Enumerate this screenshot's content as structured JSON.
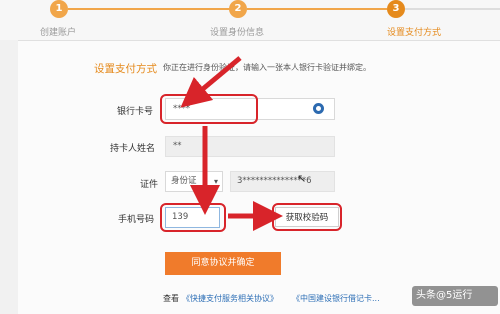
{
  "steps": [
    {
      "num": "1",
      "label": "创建账户"
    },
    {
      "num": "2",
      "label": "设置身份信息"
    },
    {
      "num": "3",
      "label": "设置支付方式"
    }
  ],
  "section": {
    "title": "设置支付方式",
    "desc": "你正在进行身份验证，请输入一张本人银行卡验证并绑定。"
  },
  "form": {
    "card_label": "银行卡号",
    "card_value": "****",
    "name_label": "持卡人姓名",
    "name_value": "**",
    "id_label": "证件",
    "id_type": "身份证",
    "id_value": "3***************6",
    "phone_label": "手机号码",
    "phone_value": "139",
    "get_code": "获取校验码"
  },
  "submit": "同意协议并确定",
  "footer": {
    "prefix": "查看",
    "link1": "《快捷支付服务相关协议》",
    "link2": "《中国建设银行借记卡..."
  },
  "watermark": "头条@5运行",
  "colors": {
    "accent": "#e58a1c",
    "button": "#f07b2b",
    "annotation": "#d8242a",
    "link": "#2d6fb6"
  }
}
